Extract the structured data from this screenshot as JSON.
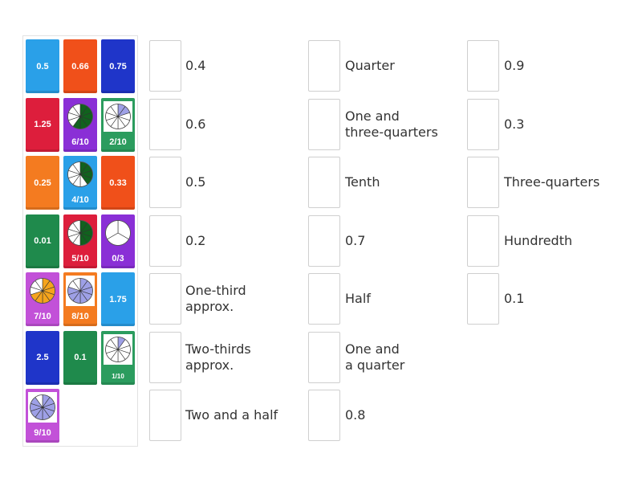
{
  "colors": {
    "light_blue": "#2aa0e8",
    "red_orange": "#f0501a",
    "dark_blue": "#1f35c9",
    "crimson": "#dd1e3c",
    "purple": "#8a2fd6",
    "green": "#2b9c5e",
    "orange": "#f47b20",
    "dark_green": "#1f8a4c",
    "magenta": "#c251d8",
    "fraction_green": "#11621e",
    "fraction_orange": "#f5a41c",
    "fraction_lavender": "#9ea0e6"
  },
  "cards": [
    {
      "kind": "text",
      "text": "0.5",
      "color": "light_blue"
    },
    {
      "kind": "text",
      "text": "0.66",
      "color": "red_orange"
    },
    {
      "kind": "text",
      "text": "0.75",
      "color": "dark_blue"
    },
    {
      "kind": "text",
      "text": "1.25",
      "color": "crimson"
    },
    {
      "kind": "fraction",
      "caption": "6/10",
      "color": "purple",
      "icon": "circle-6-of-10-icon",
      "fill": "fraction_green",
      "parts": 10,
      "shaded": 6
    },
    {
      "kind": "fraction",
      "caption": "2/10",
      "color": "green",
      "icon": "circle-2-of-10-icon",
      "fill": "fraction_lavender",
      "parts": 10,
      "shaded": 2
    },
    {
      "kind": "text",
      "text": "0.25",
      "color": "orange"
    },
    {
      "kind": "fraction",
      "caption": "4/10",
      "color": "light_blue",
      "icon": "circle-4-of-10-icon",
      "fill": "fraction_green",
      "parts": 10,
      "shaded": 4
    },
    {
      "kind": "text",
      "text": "0.33",
      "color": "red_orange"
    },
    {
      "kind": "text",
      "text": "0.01",
      "color": "dark_green"
    },
    {
      "kind": "fraction",
      "caption": "5/10",
      "color": "crimson",
      "icon": "circle-5-of-10-icon",
      "fill": "fraction_green",
      "parts": 10,
      "shaded": 5
    },
    {
      "kind": "fraction",
      "caption": "0/3",
      "color": "purple",
      "icon": "circle-0-of-3-icon",
      "fill": "fraction_orange",
      "parts": 3,
      "shaded": 0
    },
    {
      "kind": "fraction",
      "caption": "7/10",
      "color": "magenta",
      "icon": "circle-7-of-10-icon",
      "fill": "fraction_orange",
      "parts": 10,
      "shaded": 7
    },
    {
      "kind": "fraction",
      "caption": "8/10",
      "color": "orange",
      "icon": "circle-8-of-10-icon",
      "fill": "fraction_lavender",
      "parts": 10,
      "shaded": 8
    },
    {
      "kind": "text",
      "text": "1.75",
      "color": "light_blue"
    },
    {
      "kind": "text",
      "text": "2.5",
      "color": "dark_blue"
    },
    {
      "kind": "text",
      "text": "0.1",
      "color": "dark_green"
    },
    {
      "kind": "fraction",
      "caption": "1/10",
      "color": "green",
      "icon": "circle-1-of-10-icon",
      "fill": "fraction_lavender",
      "parts": 10,
      "shaded": 1
    },
    {
      "kind": "fraction",
      "caption": "9/10",
      "color": "magenta",
      "icon": "circle-9-of-10-icon",
      "fill": "fraction_lavender",
      "parts": 10,
      "shaded": 9
    }
  ],
  "targets": {
    "column1": [
      "0.4",
      "0.6",
      "0.5",
      "0.2",
      "One-third\napprox.",
      "Two-thirds\napprox.",
      "Two and a half"
    ],
    "column2": [
      "Quarter",
      "One and\nthree-quarters",
      "Tenth",
      "0.7",
      "Half",
      "One and\na quarter",
      "0.8"
    ],
    "column3": [
      "0.9",
      "0.3",
      "Three-quarters",
      "Hundredth",
      "0.1"
    ]
  }
}
